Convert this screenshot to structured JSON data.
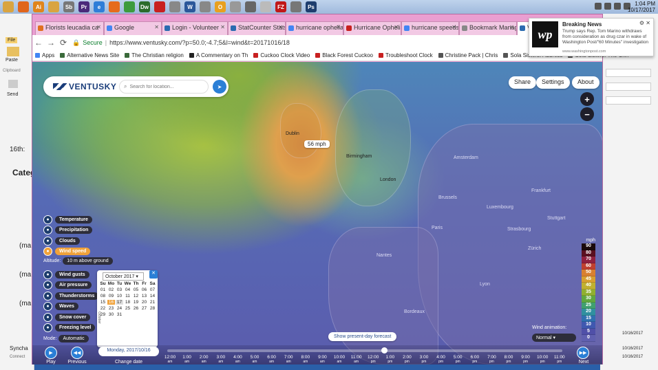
{
  "taskbar": {
    "icons": [
      {
        "name": "folder-icon",
        "color": "#d9a441",
        "glyph": ""
      },
      {
        "name": "orange-app-icon",
        "color": "#e0651c",
        "glyph": ""
      },
      {
        "name": "illustrator-icon",
        "color": "#e0851c",
        "glyph": "Ai"
      },
      {
        "name": "folder2-icon",
        "color": "#d9a441",
        "glyph": ""
      },
      {
        "name": "snagit-icon",
        "color": "#777",
        "glyph": "Sb"
      },
      {
        "name": "premiere-icon",
        "color": "#4a2a7a",
        "glyph": "Pr"
      },
      {
        "name": "ie-icon",
        "color": "#2f7ed8",
        "glyph": "e"
      },
      {
        "name": "firefox-icon",
        "color": "#e66b1c",
        "glyph": ""
      },
      {
        "name": "chrome-icon",
        "color": "#3d9b3d",
        "glyph": ""
      },
      {
        "name": "dreamweaver-icon",
        "color": "#2b6b2b",
        "glyph": "Dw"
      },
      {
        "name": "acrobat-icon",
        "color": "#c82020",
        "glyph": ""
      },
      {
        "name": "media-icon",
        "color": "#888",
        "glyph": ""
      },
      {
        "name": "word-icon",
        "color": "#2b579a",
        "glyph": "W"
      },
      {
        "name": "mail-icon",
        "color": "#888",
        "glyph": ""
      },
      {
        "name": "outlook-icon",
        "color": "#e8a020",
        "glyph": "O"
      },
      {
        "name": "globe-icon",
        "color": "#999",
        "glyph": ""
      },
      {
        "name": "notes-icon",
        "color": "#666",
        "glyph": ""
      },
      {
        "name": "itunes-icon",
        "color": "#bbb",
        "glyph": ""
      },
      {
        "name": "filezilla-icon",
        "color": "#c01818",
        "glyph": "FZ"
      },
      {
        "name": "app-icon",
        "color": "#777",
        "glyph": ""
      },
      {
        "name": "photoshop-icon",
        "color": "#1d3d6e",
        "glyph": "Ps"
      }
    ],
    "time": "1:04 PM",
    "date": "10/17/2017"
  },
  "left_app": {
    "file_label": "File",
    "paste_label": "Paste",
    "clipboard_label": "Clipboard",
    "send_label": "Send",
    "text1": "16th:",
    "text2": "Categ",
    "text3": "(ma",
    "text4": "(ma",
    "text5": "(ma",
    "sync_label": "Syncha",
    "connect_label": "Connect"
  },
  "right_app": {
    "dates": [
      "10/16/2017",
      "10/16/2017",
      "10/16/2017"
    ]
  },
  "tabs": [
    {
      "label": "Florists leucadia ca",
      "color": "#e07020",
      "active": false
    },
    {
      "label": "Google",
      "color": "#4285f4",
      "active": false
    },
    {
      "label": "Login - Volunteer",
      "color": "#2b6bb0",
      "active": false
    },
    {
      "label": "StatCounter Stats",
      "color": "#2b6bb0",
      "active": false
    },
    {
      "label": "hurricane ophelia",
      "color": "#4285f4",
      "active": false
    },
    {
      "label": "Hurricane Ophelia",
      "color": "#c82020",
      "active": false
    },
    {
      "label": "hurricane speeds",
      "color": "#4285f4",
      "active": false
    },
    {
      "label": "Bookmark Manager",
      "color": "#888",
      "active": false
    },
    {
      "label": "Ventusky - W",
      "color": "#2b6bb0",
      "active": true
    }
  ],
  "address": {
    "secure": "Secure",
    "url": "https://www.ventusky.com/?p=50.0;-4.7;5&l=wind&t=20171016/18"
  },
  "bookmarks": [
    {
      "label": "Apps",
      "color": "#4285f4"
    },
    {
      "label": "Alternative News Site",
      "color": "#3a6a3a"
    },
    {
      "label": "The Christian religion",
      "color": "#3a6a3a"
    },
    {
      "label": "A Commentary on Th",
      "color": "#222"
    },
    {
      "label": "Cuckoo Clock Video",
      "color": "#c82020"
    },
    {
      "label": "Black Forest Cuckoo",
      "color": "#c82020"
    },
    {
      "label": "Troubleshoot Clock",
      "color": "#c82020"
    },
    {
      "label": "Christine Pack | Chris",
      "color": "#555"
    },
    {
      "label": "Sola Sisters: Address",
      "color": "#555"
    },
    {
      "label": "Sola Sisters: The Chri",
      "color": "#555"
    }
  ],
  "ventusky": {
    "brand": "VENTUSKY",
    "search_placeholder": "Search for location...",
    "share": "Share",
    "settings": "Settings",
    "about": "About",
    "zoom_in": "+",
    "zoom_out": "−",
    "bubble": "56 mph",
    "cities": [
      {
        "name": "Dublin",
        "light": false
      },
      {
        "name": "Birmingham",
        "light": false
      },
      {
        "name": "London",
        "light": false
      },
      {
        "name": "Amsterdam",
        "light": true
      },
      {
        "name": "Brussels",
        "light": true
      },
      {
        "name": "Frankfurt",
        "light": true
      },
      {
        "name": "Paris",
        "light": true
      },
      {
        "name": "Nantes",
        "light": true
      },
      {
        "name": "Stuttgart",
        "light": true
      },
      {
        "name": "Luxembourg",
        "light": true
      },
      {
        "name": "Strasbourg",
        "light": true
      },
      {
        "name": "Zürich",
        "light": true
      },
      {
        "name": "Lyon",
        "light": true
      },
      {
        "name": "Bordeaux",
        "light": true
      }
    ],
    "layers": [
      {
        "label": "Temperature",
        "active": false
      },
      {
        "label": "Precipitation",
        "active": false
      },
      {
        "label": "Clouds",
        "active": false
      },
      {
        "label": "Wind speed",
        "active": true
      }
    ],
    "altitude_label": "Altitude:",
    "altitude_value": "10 m above ground",
    "layers2": [
      {
        "label": "Wind gusts"
      },
      {
        "label": "Air pressure"
      },
      {
        "label": "Thunderstorms"
      },
      {
        "label": "Waves"
      },
      {
        "label": "Snow cover"
      },
      {
        "label": "Freezing level"
      }
    ],
    "mode_label": "Mode:",
    "mode_value": "Automatic",
    "calendar": {
      "month": "October 2017",
      "side": "October",
      "headers": [
        "Su",
        "Mo",
        "Tu",
        "We",
        "Th",
        "Fr",
        "Sa"
      ],
      "days": [
        "01",
        "02",
        "03",
        "04",
        "05",
        "06",
        "07",
        "08",
        "09",
        "10",
        "11",
        "12",
        "13",
        "14",
        "15",
        "16",
        "17",
        "18",
        "19",
        "20",
        "21",
        "22",
        "23",
        "24",
        "25",
        "26",
        "27",
        "28",
        "29",
        "30",
        "31"
      ],
      "selected": "16",
      "highlight": "17"
    },
    "date_label": "Monday, 2017/10/16",
    "play": "Play",
    "previous": "Previous",
    "change_date": "Change date",
    "next": "Next",
    "forecast_btn": "Show present-day forecast",
    "wind_anim_label": "Wind animation:",
    "wind_anim_value": "Normal",
    "legend_title": "mph",
    "legend": [
      {
        "v": "90",
        "c": "#1a0a0a"
      },
      {
        "v": "80",
        "c": "#5a1020"
      },
      {
        "v": "70",
        "c": "#902040"
      },
      {
        "v": "60",
        "c": "#c04030"
      },
      {
        "v": "50",
        "c": "#d88030"
      },
      {
        "v": "45",
        "c": "#d8a030"
      },
      {
        "v": "40",
        "c": "#c0b030"
      },
      {
        "v": "35",
        "c": "#90b030"
      },
      {
        "v": "30",
        "c": "#60a840"
      },
      {
        "v": "25",
        "c": "#40a070"
      },
      {
        "v": "20",
        "c": "#3090a0"
      },
      {
        "v": "15",
        "c": "#3070b0"
      },
      {
        "v": "10",
        "c": "#4058b0"
      },
      {
        "v": "5",
        "c": "#5050a8"
      },
      {
        "v": "0",
        "c": "#6060b0"
      }
    ],
    "hours": [
      {
        "t": "12:00",
        "p": "am"
      },
      {
        "t": "1:00",
        "p": "am"
      },
      {
        "t": "2:00",
        "p": "am"
      },
      {
        "t": "3:00",
        "p": "am"
      },
      {
        "t": "4:00",
        "p": "am"
      },
      {
        "t": "5:00",
        "p": "am"
      },
      {
        "t": "6:00",
        "p": "am"
      },
      {
        "t": "7:00",
        "p": "am"
      },
      {
        "t": "8:00",
        "p": "am"
      },
      {
        "t": "9:00",
        "p": "am"
      },
      {
        "t": "10:00",
        "p": "am"
      },
      {
        "t": "11:00",
        "p": "am"
      },
      {
        "t": "12:00",
        "p": "pm"
      },
      {
        "t": "1:00",
        "p": "pm"
      },
      {
        "t": "2:00",
        "p": "pm"
      },
      {
        "t": "3:00",
        "p": "pm"
      },
      {
        "t": "4:00",
        "p": "pm"
      },
      {
        "t": "5:00",
        "p": "pm"
      },
      {
        "t": "6:00",
        "p": "pm"
      },
      {
        "t": "7:00",
        "p": "pm"
      },
      {
        "t": "8:00",
        "p": "pm"
      },
      {
        "t": "9:00",
        "p": "pm"
      },
      {
        "t": "10:00",
        "p": "pm"
      },
      {
        "t": "11:00",
        "p": "pm"
      }
    ]
  },
  "notification": {
    "logo": "wp",
    "title": "Breaking News",
    "body": "Trump says Rep. Tom Marino withdraws from consideration as drug czar in wake of Washington Post/\"60 Minutes\" investigation",
    "source": "www.washingtonpost.com"
  }
}
